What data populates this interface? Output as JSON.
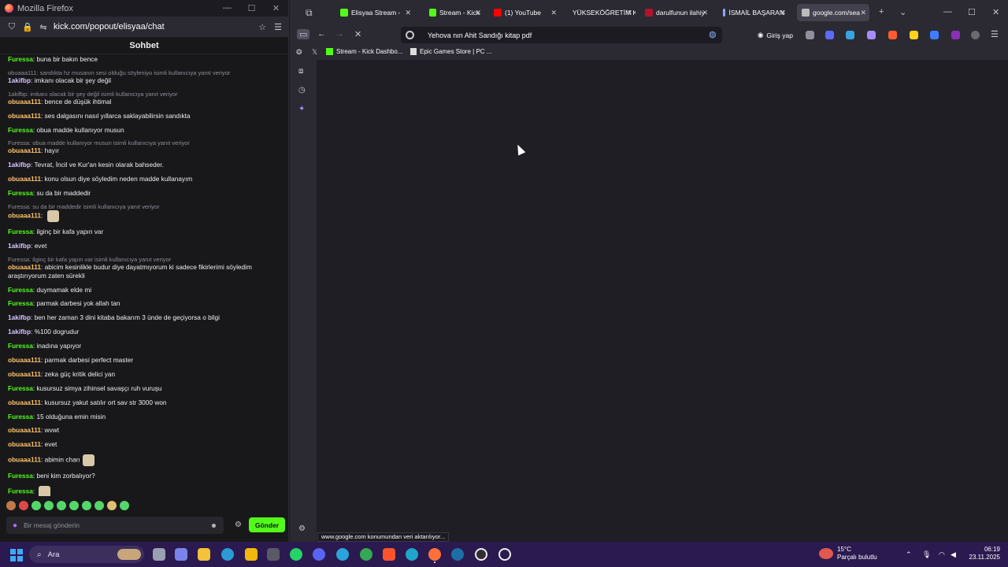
{
  "popup": {
    "title": "Mozilla Firefox",
    "url": "kick.com/popout/elisyaa/chat",
    "chat_title": "Sohbet",
    "messages": [
      {
        "reply": "",
        "user": "Furessa",
        "color": "g",
        "text": "buna bir bakın bence"
      },
      {
        "reply": "obuaaa111: sandıkta hz musanın sesi olduğu söyleniyo isimli kullanıcıya yanıt veriyor",
        "user": "1akifbp",
        "color": "w",
        "text": "imkanı olacak bir şey değil"
      },
      {
        "reply": "1akifbp: imkanı olacak bir şey değil isimli kullanıcıya yanıt veriyor",
        "user": "obuaaa111",
        "color": "o",
        "text": "bence de düşük ihtimal"
      },
      {
        "reply": "",
        "user": "obuaaa111",
        "color": "o",
        "text": "ses dalgasını nasıl yıllarca saklayabilirsin sandıkta"
      },
      {
        "reply": "",
        "user": "Furessa",
        "color": "g",
        "text": "obua madde kullanıyor musun"
      },
      {
        "reply": "Furessa: obua madde kullanıyor musun isimli kullanıcıya yanıt veriyor",
        "user": "obuaaa111",
        "color": "o",
        "text": "hayır"
      },
      {
        "reply": "",
        "user": "1akifbp",
        "color": "w",
        "text": "Tevrat, İncil ve Kur'an kesin olarak bahseder."
      },
      {
        "reply": "",
        "user": "obuaaa111",
        "color": "o",
        "text": "konu olsun diye söyledim neden madde kullanayım"
      },
      {
        "reply": "",
        "user": "Furessa",
        "color": "g",
        "text": "su da bir maddedir"
      },
      {
        "reply": "Furessa: su da bir maddedir isimli kullanıcıya yanıt veriyor",
        "user": "obuaaa111",
        "color": "o",
        "text": "",
        "emote": true
      },
      {
        "reply": "",
        "user": "Furessa",
        "color": "g",
        "text": "ilginç bir kafa yapın var"
      },
      {
        "reply": "",
        "user": "1akifbp",
        "color": "w",
        "text": "evet"
      },
      {
        "reply": "Furessa: ilginç bir kafa yapın var isimli kullanıcıya yanıt veriyor",
        "user": "obuaaa111",
        "color": "o",
        "text": "abicim kesinlikle budur diye dayatmıyorum ki sadece fikirlerimi söyledim araştırıyorum zaten sürekli"
      },
      {
        "reply": "",
        "user": "Furessa",
        "color": "g",
        "text": "duymamak elde mi"
      },
      {
        "reply": "",
        "user": "Furessa",
        "color": "g",
        "text": "parmak darbesi yok allah tan"
      },
      {
        "reply": "",
        "user": "1akifbp",
        "color": "w",
        "text": "ben her zaman 3 dini kitaba bakarım 3 ünde de geçiyorsa o bilgi"
      },
      {
        "reply": "",
        "user": "1akifbp",
        "color": "w",
        "text": "%100 dogrudur"
      },
      {
        "reply": "",
        "user": "Furessa",
        "color": "g",
        "text": "inadına yapıyor"
      },
      {
        "reply": "",
        "user": "obuaaa111",
        "color": "o",
        "text": "parmak darbesi perfect master"
      },
      {
        "reply": "",
        "user": "obuaaa111",
        "color": "o",
        "text": "zeka güç kritik delici yan"
      },
      {
        "reply": "",
        "user": "Furessa",
        "color": "g",
        "text": "kusursuz simya zihinsel savaşçı ruh vuruşu"
      },
      {
        "reply": "",
        "user": "obuaaa111",
        "color": "o",
        "text": "kusursuz yakut satılır ort sav str 3000 won"
      },
      {
        "reply": "",
        "user": "Furessa",
        "color": "g",
        "text": "15 olduğuna emin misin"
      },
      {
        "reply": "",
        "user": "obuaaa111",
        "color": "o",
        "text": "wvwt"
      },
      {
        "reply": "",
        "user": "obuaaa111",
        "color": "o",
        "text": "evet"
      },
      {
        "reply": "",
        "user": "obuaaa111",
        "color": "o",
        "text": "abimin charı",
        "emote": true
      },
      {
        "reply": "",
        "user": "Furessa",
        "color": "g",
        "text": "beni kim zorbalıyor?"
      },
      {
        "reply": "",
        "user": "Furessa",
        "color": "g",
        "text": "",
        "emote": true
      }
    ],
    "input_placeholder": "Bir mesaj gönderin",
    "send_label": "Gönder"
  },
  "browser": {
    "tabs": [
      {
        "label": "Elisyaa Stream -",
        "icon_color": "#53fc18"
      },
      {
        "label": "Stream - Kick",
        "icon_color": "#53fc18"
      },
      {
        "label": "(1) YouTube",
        "icon_color": "#ff0000"
      },
      {
        "label": "YÜKSEKÖĞRETİM KU",
        "icon_color": "#2b2a33"
      },
      {
        "label": "darulfunun ilahiy",
        "icon_color": "#b1142c"
      },
      {
        "label": "İSMAİL BAŞARAN",
        "icon_color": "#8aa8ff"
      },
      {
        "label": "google.com/sea",
        "icon_color": "#bbbbbb"
      }
    ],
    "address": "Yehova nın Ahit Sandığı kitap pdf",
    "login_label": "Giriş yap",
    "bookmarks": [
      {
        "label": "Stream - Kick Dashbo..."
      },
      {
        "label": "Epic Games Store | PC ..."
      }
    ],
    "status_text": "www.google.com konumundan veri aktarılıyor..."
  },
  "taskbar": {
    "search_label": "Ara",
    "weather_temp": "15°C",
    "weather_desc": "Parçalı bulutlu",
    "time": "06:19",
    "date": "23.11.2025"
  }
}
